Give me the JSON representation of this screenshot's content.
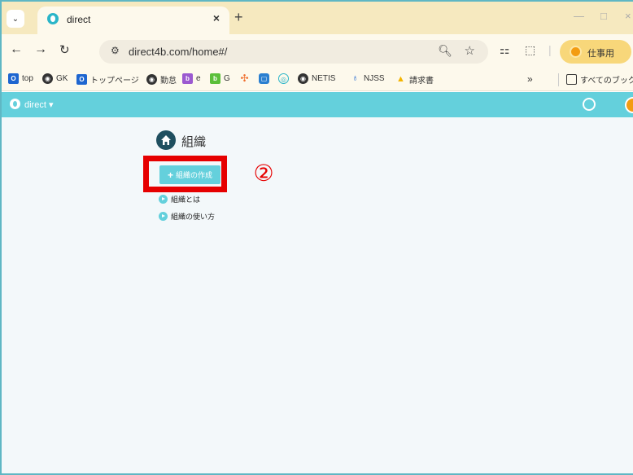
{
  "browser": {
    "tab_menu_icon": "chevron-down-icon",
    "tab_title": "direct",
    "tab_close": "×",
    "new_tab": "+",
    "minimize": "—",
    "maximize": "□",
    "close_window": "×",
    "url": "direct4b.com/home#/",
    "profile_label": "仕事用"
  },
  "bookmarks": [
    {
      "label": "top",
      "icon": "top-bookmark-icon"
    },
    {
      "label": "GK",
      "icon": "globe-icon"
    },
    {
      "label": "トップページ",
      "icon": "toppage-bookmark-icon"
    },
    {
      "label": "勤怠",
      "icon": "globe-icon"
    },
    {
      "label": "e",
      "icon": "b-bookmark-icon"
    },
    {
      "label": "G",
      "icon": "b-bookmark-icon"
    },
    {
      "label": "NETIS",
      "icon": "globe-icon"
    },
    {
      "label": "NJSS",
      "icon": "njss-icon"
    },
    {
      "label": "請求書",
      "icon": "drive-icon"
    },
    {
      "label": "すべてのブックマーク",
      "icon": "folder-icon"
    }
  ],
  "app": {
    "title": "direct ▾"
  },
  "main": {
    "page_title": "組織",
    "create_button": "組織の作成",
    "links": [
      "組織とは",
      "組織の使い方"
    ],
    "annotation": "②"
  },
  "colors": {
    "accent": "#64d0dc",
    "highlight": "#e60000",
    "tabstrip": "#f6e9bf"
  }
}
